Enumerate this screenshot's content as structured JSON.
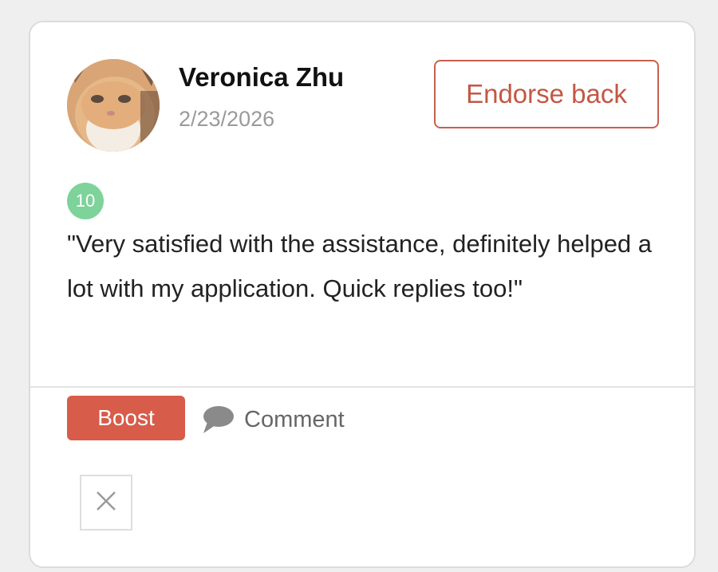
{
  "review": {
    "author_name": "Veronica Zhu",
    "date": "2/23/2026",
    "endorse_label": "Endorse back",
    "score": "10",
    "text": "\"Very satisfied with the assistance, definitely helped a lot with my application. Quick replies too!\""
  },
  "actions": {
    "boost_label": "Boost",
    "comment_label": "Comment",
    "comment_icon": "speech-bubble-icon",
    "close_icon": "close-icon"
  },
  "colors": {
    "accent": "#d75c4a",
    "endorse_border": "#c8604f",
    "score_badge": "#7dd39a",
    "date_text": "#9a9a9a"
  }
}
